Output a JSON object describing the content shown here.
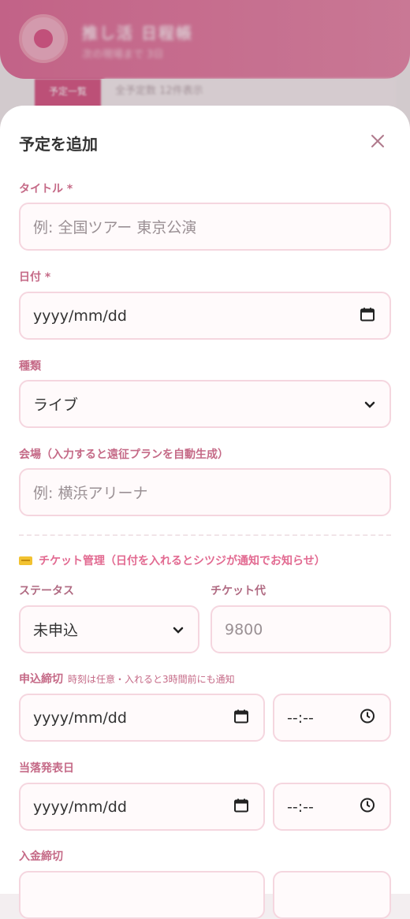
{
  "background": {
    "app_title": "推し活 日程帳",
    "app_subtitle": "次の現場まで 3日",
    "tab_active": "予定一覧",
    "tab_inactive": "全予定数 12件表示"
  },
  "modal": {
    "title": "予定を追加",
    "fields": {
      "title": {
        "label": "タイトル *",
        "placeholder": "例: 全国ツアー 東京公演"
      },
      "date": {
        "label": "日付 *",
        "value": "yyyy/mm/dd"
      },
      "type": {
        "label": "種類",
        "value": "ライブ"
      },
      "venue": {
        "label": "会場（入力すると遠征プランを自動生成）",
        "placeholder": "例: 横浜アリーナ"
      }
    },
    "ticket": {
      "heading": "チケット管理（日付を入れるとシツジが通知でお知らせ）",
      "status": {
        "label": "ステータス",
        "value": "未申込"
      },
      "price": {
        "label": "チケット代",
        "placeholder": "9800"
      },
      "apply_deadline": {
        "label": "申込締切",
        "hint": "時刻は任意・入れると3時間前にも通知",
        "date": "yyyy/mm/dd",
        "time": "--:--"
      },
      "result_date": {
        "label": "当落発表日",
        "date": "yyyy/mm/dd",
        "time": "--:--"
      },
      "payment_deadline": {
        "label": "入金締切"
      }
    }
  }
}
